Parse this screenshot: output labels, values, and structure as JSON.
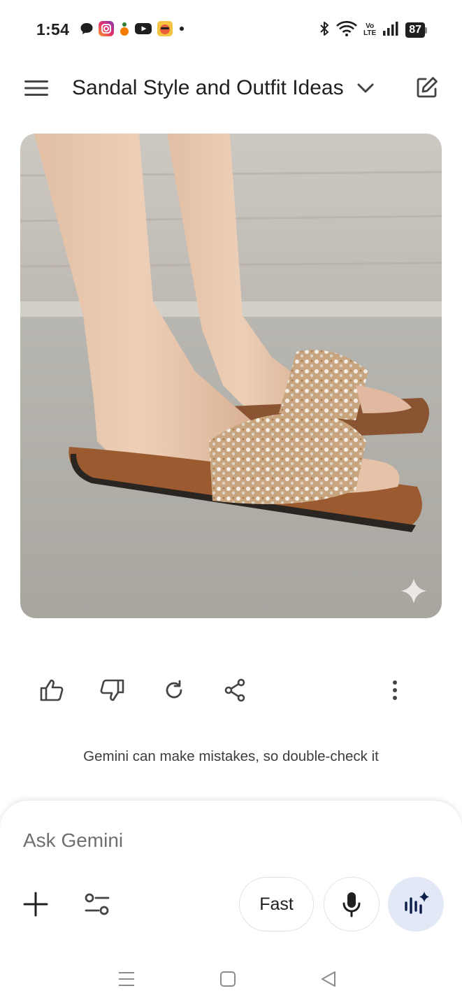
{
  "status_bar": {
    "time": "1:54",
    "battery": "87",
    "notification_icons": [
      "chat-icon",
      "instagram-icon",
      "app-icon",
      "youtube-icon",
      "avatar-app-icon",
      "more-dot-icon"
    ],
    "system_icons": [
      "bluetooth-icon",
      "wifi-icon",
      "volte-icon",
      "signal-icon",
      "battery-icon"
    ],
    "volte_top": "Vo",
    "volte_bottom": "LTE"
  },
  "header": {
    "title": "Sandal Style and Outfit Ideas",
    "menu_icon": "menu-icon",
    "dropdown_icon": "chevron-down-icon",
    "compose_icon": "edit-icon"
  },
  "image": {
    "description_icon": "gemini-sparkle-icon"
  },
  "actions": {
    "icons": [
      "thumbs-up-icon",
      "thumbs-down-icon",
      "regenerate-icon",
      "share-icon",
      "more-vert-icon"
    ]
  },
  "disclaimer": "Gemini can make mistakes, so double-check it",
  "composer": {
    "placeholder": "Ask Gemini",
    "mode_label": "Fast",
    "accent": "#e3e8f6"
  },
  "nav": {
    "icons": [
      "recents-icon",
      "home-icon",
      "back-icon"
    ]
  }
}
